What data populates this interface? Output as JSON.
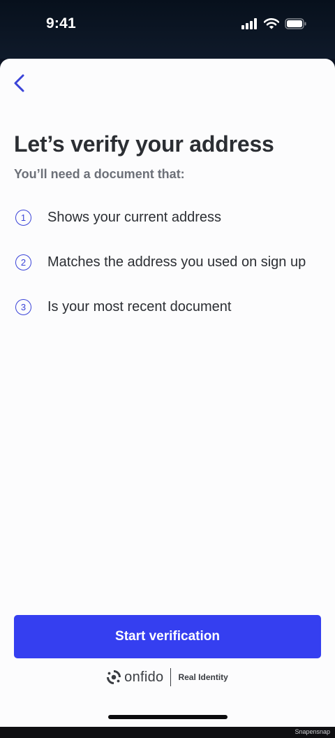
{
  "status_bar": {
    "time": "9:41"
  },
  "header": {
    "back_icon": "chevron-left-icon"
  },
  "main": {
    "title": "Let’s verify your address",
    "subtitle": "You’ll need a document that:",
    "requirements": [
      {
        "number": "1",
        "text": "Shows your current address"
      },
      {
        "number": "2",
        "text": "Matches the address you used on sign up"
      },
      {
        "number": "3",
        "text": "Is your most recent document"
      }
    ]
  },
  "actions": {
    "start_label": "Start verification"
  },
  "branding": {
    "logo_text": "onfido",
    "tagline": "Real Identity"
  },
  "footer": {
    "watermark": "Snapensnap"
  },
  "colors": {
    "accent": "#353ff0",
    "outline": "#3a43d8",
    "text": "#2b2e33",
    "muted": "#6c7078"
  }
}
